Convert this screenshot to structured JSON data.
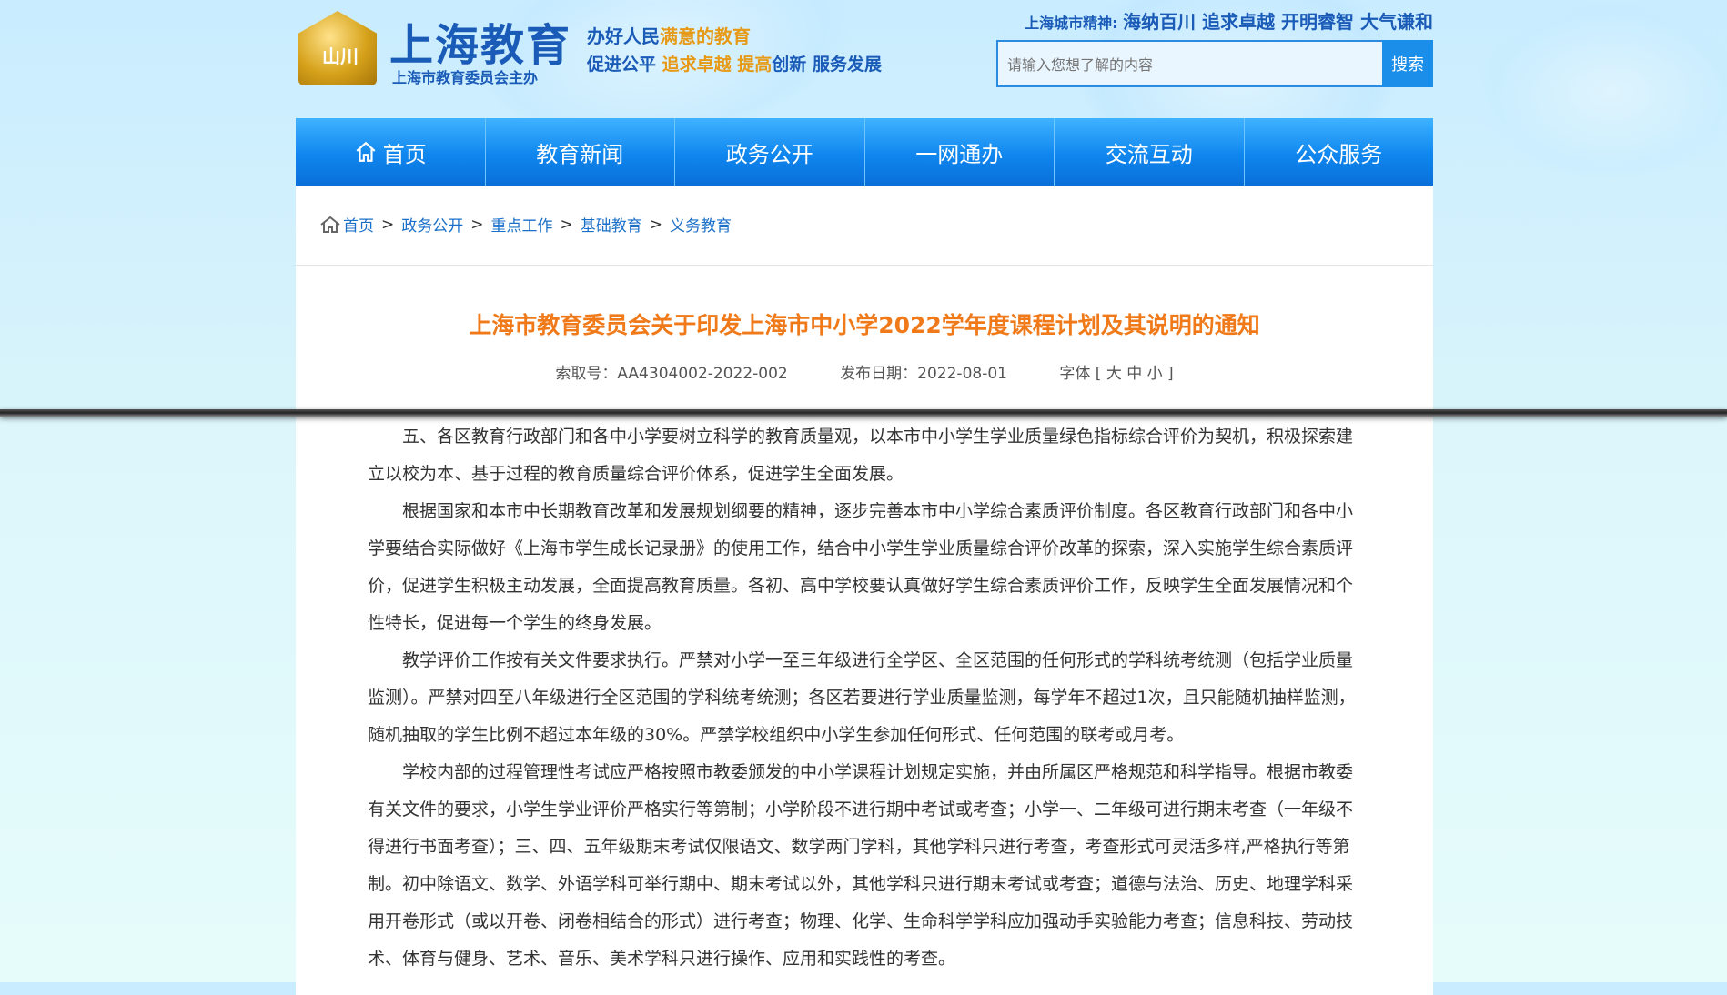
{
  "header": {
    "logo_emblem_text": "山川",
    "logo_title": "上海教育",
    "logo_sub": "上海市教育委员会主办",
    "slogan1_a": "办好人民",
    "slogan1_b": "满意的教育",
    "slogan2_a": "促进公平",
    "slogan2_b": "追求卓越",
    "slogan2_c": "提高",
    "slogan2_d": "创新",
    "slogan2_e": "服务发展",
    "spirit_label": "上海城市精神:",
    "spirit_text": "海纳百川 追求卓越 开明睿智 大气谦和",
    "search_placeholder": "请输入您想了解的内容",
    "search_button": "搜索"
  },
  "nav": {
    "items": [
      "首页",
      "教育新闻",
      "政务公开",
      "一网通办",
      "交流互动",
      "公众服务"
    ]
  },
  "breadcrumb": {
    "items": [
      "首页",
      "政务公开",
      "重点工作",
      "基础教育",
      "义务教育"
    ],
    "separator": ">"
  },
  "article": {
    "title": "上海市教育委员会关于印发上海市中小学2022学年度课程计划及其说明的通知",
    "index_no": "索取号：AA4304002-2022-002",
    "publish_date": "发布日期：2022-08-01",
    "font_size": "字体 [ 大 中 小 ]",
    "paragraphs": [
      "五、各区教育行政部门和各中小学要树立科学的教育质量观，以本市中小学生学业质量绿色指标综合评价为契机，积极探索建立以校为本、基于过程的教育质量综合评价体系，促进学生全面发展。",
      "根据国家和本市中长期教育改革和发展规划纲要的精神，逐步完善本市中小学综合素质评价制度。各区教育行政部门和各中小学要结合实际做好《上海市学生成长记录册》的使用工作，结合中小学生学业质量综合评价改革的探索，深入实施学生综合素质评价，促进学生积极主动发展，全面提高教育质量。各初、高中学校要认真做好学生综合素质评价工作，反映学生全面发展情况和个性特长，促进每一个学生的终身发展。",
      "教学评价工作按有关文件要求执行。严禁对小学一至三年级进行全学区、全区范围的任何形式的学科统考统测（包括学业质量监测）。严禁对四至八年级进行全区范围的学科统考统测；各区若要进行学业质量监测，每学年不超过1次，且只能随机抽样监测，随机抽取的学生比例不超过本年级的30%。严禁学校组织中小学生参加任何形式、任何范围的联考或月考。",
      "学校内部的过程管理性考试应严格按照市教委颁发的中小学课程计划规定实施，并由所属区严格规范和科学指导。根据市教委有关文件的要求，小学生学业评价严格实行等第制；小学阶段不进行期中考试或考查；小学一、二年级可进行期末考查（一年级不得进行书面考查）；三、四、五年级期末考试仅限语文、数学两门学科，其他学科只进行考查，考查形式可灵活多样,严格执行等第制。初中除语文、数学、外语学科可举行期中、期末考试以外，其他学科只进行期末考试或考查；道德与法治、历史、地理学科采用开卷形式（或以开卷、闭卷相结合的形式）进行考查；物理、化学、生命科学学科应加强动手实验能力考查；信息科技、劳动技术、体育与健身、艺术、音乐、美术学科只进行操作、应用和实践性的考查。"
    ]
  },
  "colors": {
    "brand_blue": "#1a5bb8",
    "nav_blue": "#0f86ee",
    "title_orange": "#f07a1a",
    "link_blue": "#1a6fc8"
  }
}
